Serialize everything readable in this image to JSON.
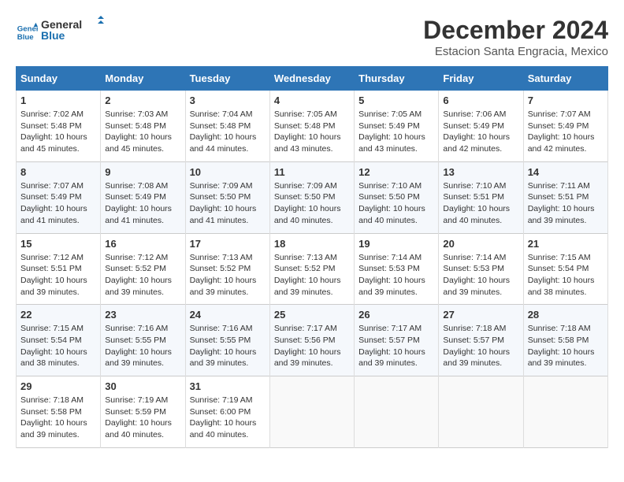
{
  "logo": {
    "line1": "General",
    "line2": "Blue"
  },
  "title": "December 2024",
  "location": "Estacion Santa Engracia, Mexico",
  "weekdays": [
    "Sunday",
    "Monday",
    "Tuesday",
    "Wednesday",
    "Thursday",
    "Friday",
    "Saturday"
  ],
  "weeks": [
    [
      {
        "day": "1",
        "sunrise": "7:02 AM",
        "sunset": "5:48 PM",
        "daylight": "10 hours and 45 minutes."
      },
      {
        "day": "2",
        "sunrise": "7:03 AM",
        "sunset": "5:48 PM",
        "daylight": "10 hours and 45 minutes."
      },
      {
        "day": "3",
        "sunrise": "7:04 AM",
        "sunset": "5:48 PM",
        "daylight": "10 hours and 44 minutes."
      },
      {
        "day": "4",
        "sunrise": "7:05 AM",
        "sunset": "5:48 PM",
        "daylight": "10 hours and 43 minutes."
      },
      {
        "day": "5",
        "sunrise": "7:05 AM",
        "sunset": "5:49 PM",
        "daylight": "10 hours and 43 minutes."
      },
      {
        "day": "6",
        "sunrise": "7:06 AM",
        "sunset": "5:49 PM",
        "daylight": "10 hours and 42 minutes."
      },
      {
        "day": "7",
        "sunrise": "7:07 AM",
        "sunset": "5:49 PM",
        "daylight": "10 hours and 42 minutes."
      }
    ],
    [
      {
        "day": "8",
        "sunrise": "7:07 AM",
        "sunset": "5:49 PM",
        "daylight": "10 hours and 41 minutes."
      },
      {
        "day": "9",
        "sunrise": "7:08 AM",
        "sunset": "5:49 PM",
        "daylight": "10 hours and 41 minutes."
      },
      {
        "day": "10",
        "sunrise": "7:09 AM",
        "sunset": "5:50 PM",
        "daylight": "10 hours and 41 minutes."
      },
      {
        "day": "11",
        "sunrise": "7:09 AM",
        "sunset": "5:50 PM",
        "daylight": "10 hours and 40 minutes."
      },
      {
        "day": "12",
        "sunrise": "7:10 AM",
        "sunset": "5:50 PM",
        "daylight": "10 hours and 40 minutes."
      },
      {
        "day": "13",
        "sunrise": "7:10 AM",
        "sunset": "5:51 PM",
        "daylight": "10 hours and 40 minutes."
      },
      {
        "day": "14",
        "sunrise": "7:11 AM",
        "sunset": "5:51 PM",
        "daylight": "10 hours and 39 minutes."
      }
    ],
    [
      {
        "day": "15",
        "sunrise": "7:12 AM",
        "sunset": "5:51 PM",
        "daylight": "10 hours and 39 minutes."
      },
      {
        "day": "16",
        "sunrise": "7:12 AM",
        "sunset": "5:52 PM",
        "daylight": "10 hours and 39 minutes."
      },
      {
        "day": "17",
        "sunrise": "7:13 AM",
        "sunset": "5:52 PM",
        "daylight": "10 hours and 39 minutes."
      },
      {
        "day": "18",
        "sunrise": "7:13 AM",
        "sunset": "5:52 PM",
        "daylight": "10 hours and 39 minutes."
      },
      {
        "day": "19",
        "sunrise": "7:14 AM",
        "sunset": "5:53 PM",
        "daylight": "10 hours and 39 minutes."
      },
      {
        "day": "20",
        "sunrise": "7:14 AM",
        "sunset": "5:53 PM",
        "daylight": "10 hours and 39 minutes."
      },
      {
        "day": "21",
        "sunrise": "7:15 AM",
        "sunset": "5:54 PM",
        "daylight": "10 hours and 38 minutes."
      }
    ],
    [
      {
        "day": "22",
        "sunrise": "7:15 AM",
        "sunset": "5:54 PM",
        "daylight": "10 hours and 38 minutes."
      },
      {
        "day": "23",
        "sunrise": "7:16 AM",
        "sunset": "5:55 PM",
        "daylight": "10 hours and 39 minutes."
      },
      {
        "day": "24",
        "sunrise": "7:16 AM",
        "sunset": "5:55 PM",
        "daylight": "10 hours and 39 minutes."
      },
      {
        "day": "25",
        "sunrise": "7:17 AM",
        "sunset": "5:56 PM",
        "daylight": "10 hours and 39 minutes."
      },
      {
        "day": "26",
        "sunrise": "7:17 AM",
        "sunset": "5:57 PM",
        "daylight": "10 hours and 39 minutes."
      },
      {
        "day": "27",
        "sunrise": "7:18 AM",
        "sunset": "5:57 PM",
        "daylight": "10 hours and 39 minutes."
      },
      {
        "day": "28",
        "sunrise": "7:18 AM",
        "sunset": "5:58 PM",
        "daylight": "10 hours and 39 minutes."
      }
    ],
    [
      {
        "day": "29",
        "sunrise": "7:18 AM",
        "sunset": "5:58 PM",
        "daylight": "10 hours and 39 minutes."
      },
      {
        "day": "30",
        "sunrise": "7:19 AM",
        "sunset": "5:59 PM",
        "daylight": "10 hours and 40 minutes."
      },
      {
        "day": "31",
        "sunrise": "7:19 AM",
        "sunset": "6:00 PM",
        "daylight": "10 hours and 40 minutes."
      },
      null,
      null,
      null,
      null
    ]
  ]
}
